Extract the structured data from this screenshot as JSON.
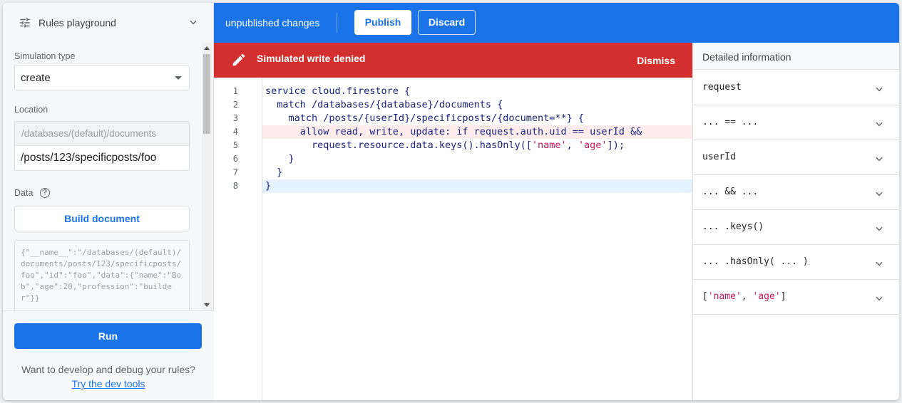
{
  "left": {
    "title": "Rules playground",
    "simulation_type_label": "Simulation type",
    "simulation_type_value": "create",
    "location_label": "Location",
    "location_prefix": "/databases/(default)/documents",
    "location_value": "/posts/123/specificposts/foo",
    "data_label": "Data",
    "help_glyph": "?",
    "build_document": "Build document",
    "json_preview": "{\"__name__\":\"/databases/(default)/documents/posts/123/specificposts/foo\",\"id\":\"foo\",\"data\":{\"name\":\"Bob\",\"age\":20,\"profession\":\"builder\"}}",
    "run": "Run",
    "dev_text": "Want to develop and debug your rules?",
    "dev_link": "Try the dev tools"
  },
  "topbar": {
    "status": "unpublished changes",
    "publish": "Publish",
    "discard": "Discard"
  },
  "banner": {
    "message": "Simulated write denied",
    "dismiss": "Dismiss"
  },
  "editor": {
    "line_numbers": [
      "1",
      "2",
      "3",
      "4",
      "5",
      "6",
      "7",
      "8"
    ],
    "error_line": 4,
    "current_line": 8
  },
  "right": {
    "title": "Detailed information",
    "items": [
      "request",
      "... == ...",
      "userId",
      "... && ...",
      "... .keys()",
      "... .hasOnly( ... )",
      "['name', 'age']"
    ]
  },
  "colors": {
    "primary": "#1a73e8",
    "error": "#d32f2f",
    "string": "#c2185b"
  }
}
